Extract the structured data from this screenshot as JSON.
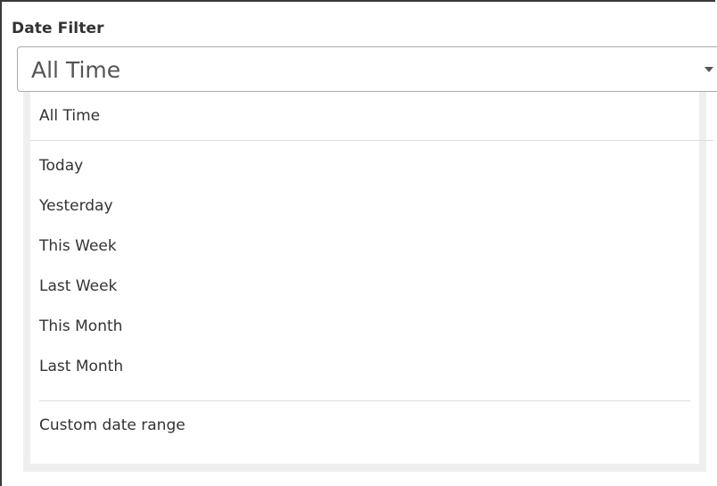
{
  "filter": {
    "label": "Date Filter",
    "selected_value": "All Time",
    "caret_icon": "caret-down-icon"
  },
  "dropdown": {
    "options": [
      {
        "label": "All Time"
      },
      {
        "label": "Today"
      },
      {
        "label": "Yesterday"
      },
      {
        "label": "This Week"
      },
      {
        "label": "Last Week"
      },
      {
        "label": "This Month"
      },
      {
        "label": "Last Month"
      },
      {
        "label": "Custom date range"
      }
    ]
  }
}
